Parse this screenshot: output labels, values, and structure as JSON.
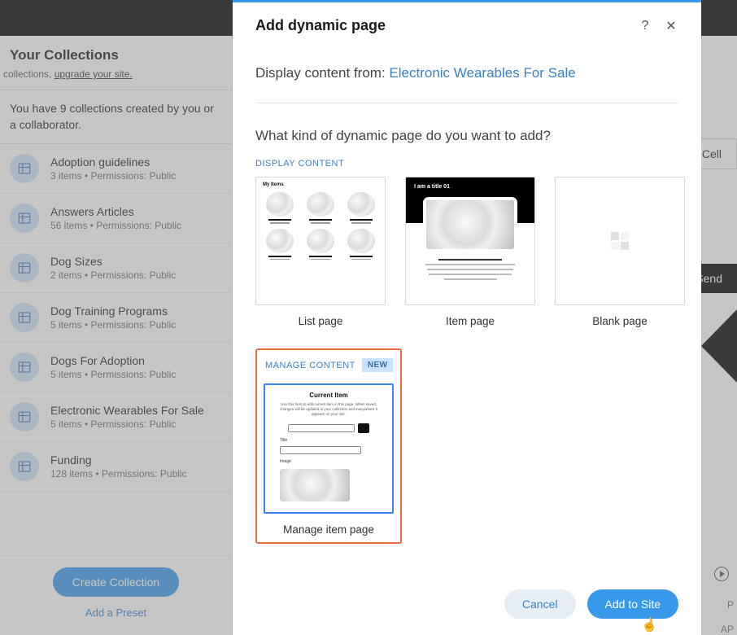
{
  "sidebar": {
    "title": "Your Collections",
    "upgrade_prefix": "collections, ",
    "upgrade_link": "upgrade your site.",
    "created_text": "You have 9 collections created by you or a collaborator.",
    "items": [
      {
        "name": "Adoption guidelines",
        "meta": "3 items • Permissions: Public"
      },
      {
        "name": "Answers Articles",
        "meta": "56 items • Permissions: Public"
      },
      {
        "name": "Dog Sizes",
        "meta": "2 items • Permissions: Public"
      },
      {
        "name": "Dog Training Programs",
        "meta": "5 items • Permissions: Public"
      },
      {
        "name": "Dogs For Adoption",
        "meta": "5 items • Permissions: Public"
      },
      {
        "name": "Electronic Wearables For Sale",
        "meta": "5 items • Permissions: Public"
      },
      {
        "name": "Funding",
        "meta": "128 items • Permissions: Public"
      }
    ],
    "create_label": "Create Collection",
    "preset_label": "Add a Preset"
  },
  "background": {
    "cell_label": "Cell",
    "send_label": "Send",
    "p_label": "P",
    "ap_label": "AP"
  },
  "modal": {
    "title": "Add dynamic page",
    "display_from_prefix": "Display content from: ",
    "collection_name": "Electronic Wearables For Sale",
    "question": "What kind of dynamic page do you want to add?",
    "display_content_label": "DISPLAY CONTENT",
    "manage_content_label": "MANAGE CONTENT",
    "new_badge": "NEW",
    "options": {
      "list": "List page",
      "item": "Item page",
      "blank": "Blank page",
      "manage": "Manage item page"
    },
    "list_thumb_title": "My Items",
    "item_thumb_title": "I am a title 01",
    "manage_thumb": {
      "title": "Current Item",
      "sub": "Use this form to edit current item in this page. When saved, changes will be updated in your collection and everywhere it appears on your site.",
      "field_title": "Title",
      "field_image": "Image"
    },
    "cancel_label": "Cancel",
    "add_label": "Add to Site"
  }
}
